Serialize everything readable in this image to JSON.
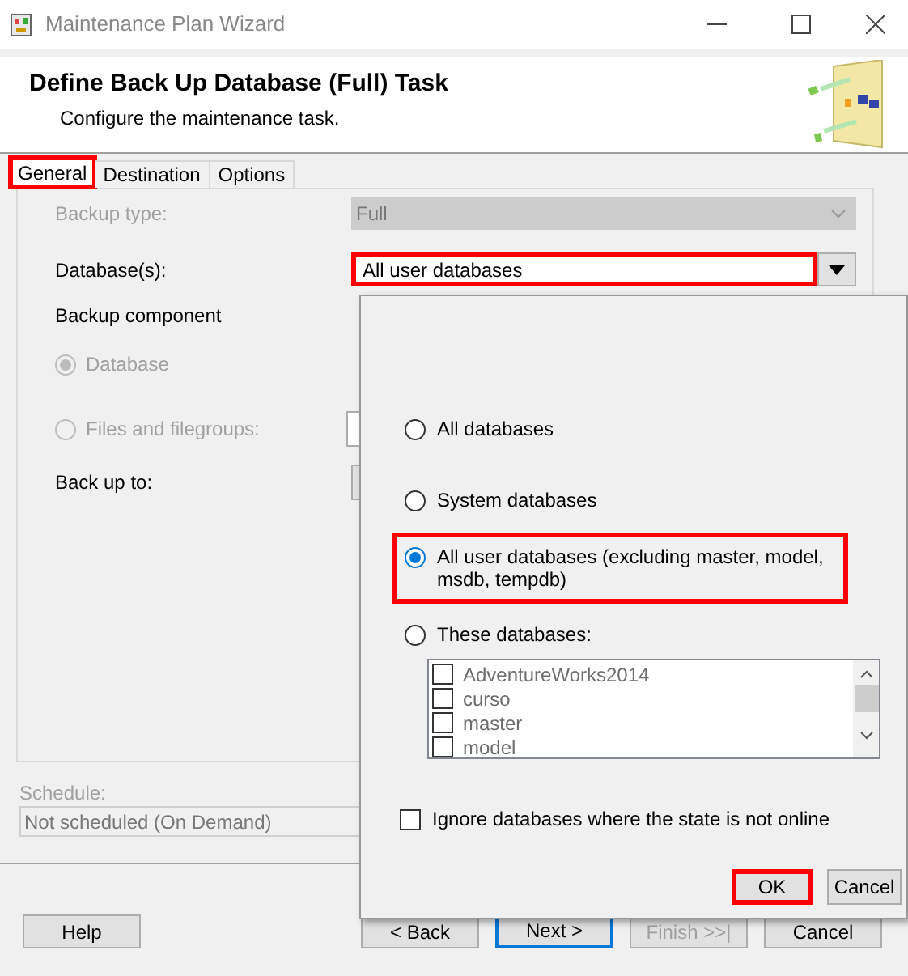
{
  "window": {
    "title": "Maintenance Plan Wizard"
  },
  "header": {
    "title": "Define Back Up Database (Full) Task",
    "subtitle": "Configure the maintenance task."
  },
  "tabs": [
    {
      "label": "General",
      "selected": true,
      "highlighted": true
    },
    {
      "label": "Destination",
      "selected": false,
      "highlighted": false
    },
    {
      "label": "Options",
      "selected": false,
      "highlighted": false
    }
  ],
  "form": {
    "backup_type": {
      "label": "Backup type:",
      "value": "Full",
      "disabled": true
    },
    "databases": {
      "label": "Database(s):",
      "value": "All user databases",
      "highlighted": true
    },
    "backup_component": {
      "label": "Backup component",
      "options": [
        {
          "label": "Database",
          "selected": true,
          "disabled": true
        },
        {
          "label": "Files and filegroups:",
          "selected": false,
          "disabled": true
        }
      ]
    },
    "back_up_to": {
      "label": "Back up to:"
    }
  },
  "schedule": {
    "label": "Schedule:",
    "value": "Not scheduled (On Demand)",
    "disabled": true
  },
  "buttons": [
    {
      "label": "Help",
      "default": false,
      "disabled": false
    },
    {
      "label": "< Back",
      "default": false,
      "disabled": false
    },
    {
      "label": "Next >",
      "default": true,
      "disabled": false
    },
    {
      "label": "Finish >>|",
      "default": false,
      "disabled": true
    },
    {
      "label": "Cancel",
      "default": false,
      "disabled": false
    }
  ],
  "popup": {
    "options": [
      {
        "label": "All databases",
        "selected": false,
        "highlighted": false
      },
      {
        "label": "System databases",
        "selected": false,
        "highlighted": false
      },
      {
        "label": "All user databases  (excluding master, model, msdb, tempdb)",
        "selected": true,
        "highlighted": true
      },
      {
        "label": "These databases:",
        "selected": false,
        "highlighted": false
      }
    ],
    "databases": [
      {
        "name": "AdventureWorks2014",
        "checked": false
      },
      {
        "name": "curso",
        "checked": false
      },
      {
        "name": "master",
        "checked": false
      },
      {
        "name": "model",
        "checked": false
      }
    ],
    "ignore_offline": {
      "label": "Ignore databases where the state is not online",
      "checked": false
    },
    "buttons": [
      {
        "label": "OK",
        "highlighted": true
      },
      {
        "label": "Cancel",
        "highlighted": false
      }
    ]
  }
}
